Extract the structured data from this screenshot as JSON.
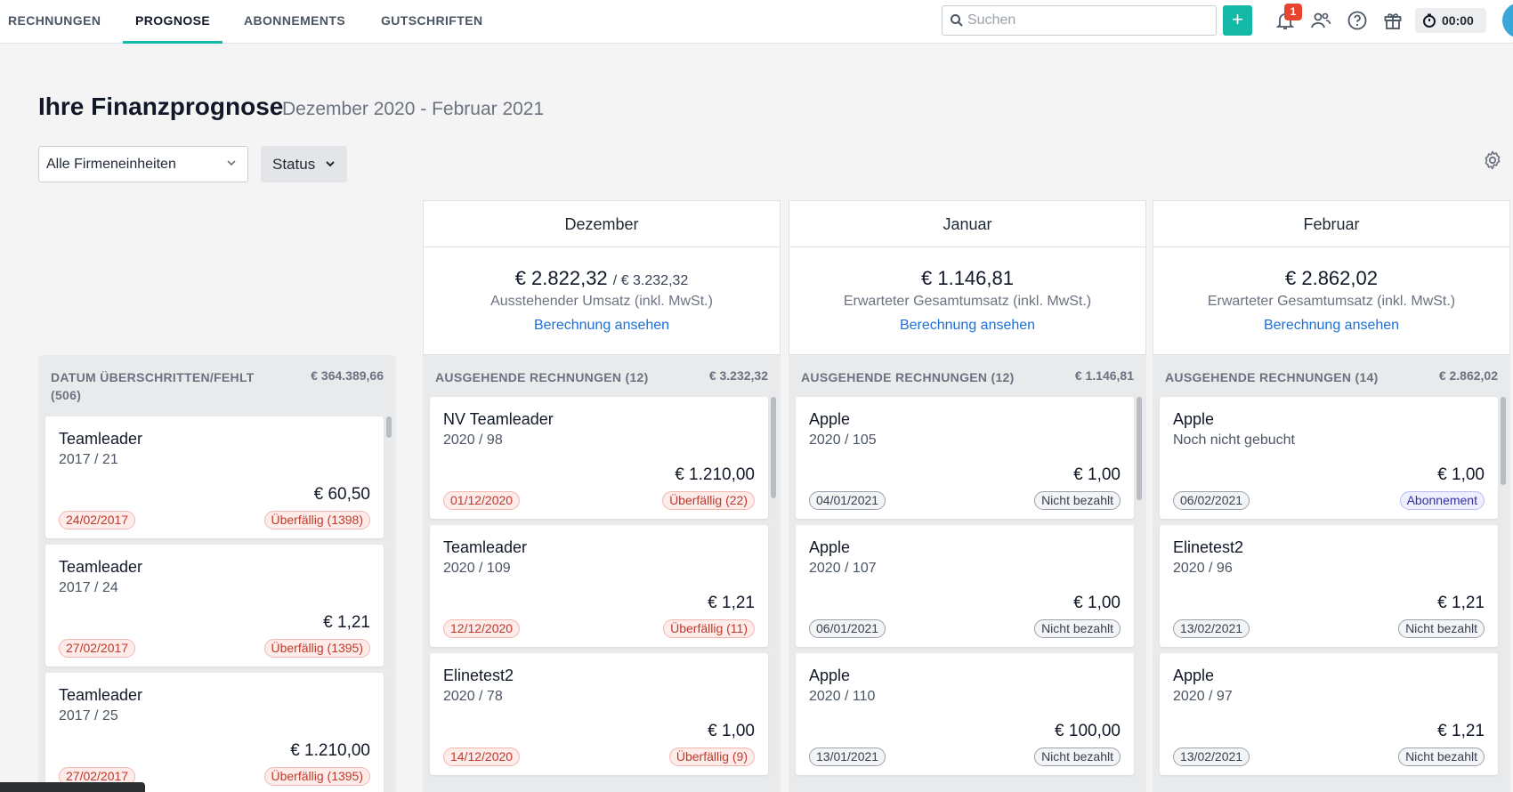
{
  "nav": {
    "tabs": [
      {
        "label": "RECHNUNGEN"
      },
      {
        "label": "PROGNOSE"
      },
      {
        "label": "ABONNEMENTS"
      },
      {
        "label": "GUTSCHRIFTEN"
      }
    ],
    "search_placeholder": "Suchen",
    "add_label": "+",
    "notification_count": "1",
    "timer": "00:00"
  },
  "heading": {
    "title": "Ihre Finanzprognose",
    "range": "Dezember 2020 - Februar 2021"
  },
  "filters": {
    "entity": "Alle Firmeneinheiten",
    "status": "Status"
  },
  "months": [
    {
      "title": "Dezember",
      "amount": "€ 2.822,32",
      "secondary": "/ € 3.232,32",
      "desc": "Ausstehender Umsatz (inkl. MwSt.)",
      "link": "Berechnung ansehen"
    },
    {
      "title": "Januar",
      "amount": "€ 1.146,81",
      "secondary": "",
      "desc": "Erwarteter Gesamtumsatz (inkl. MwSt.)",
      "link": "Berechnung ansehen"
    },
    {
      "title": "Februar",
      "amount": "€ 2.862,02",
      "secondary": "",
      "desc": "Erwarteter Gesamtumsatz (inkl. MwSt.)",
      "link": "Berechnung ansehen"
    }
  ],
  "columns": [
    {
      "header": "DATUM ÜBERSCHRITTEN/FEHLT (506)",
      "total": "€ 364.389,66",
      "cards": [
        {
          "name": "Teamleader",
          "number": "2017 / 21",
          "amount": "€ 60,50",
          "date": "24/02/2017",
          "status": "Überfällig (1398)",
          "date_style": "red",
          "status_style": "red"
        },
        {
          "name": "Teamleader",
          "number": "2017 / 24",
          "amount": "€ 1,21",
          "date": "27/02/2017",
          "status": "Überfällig (1395)",
          "date_style": "red",
          "status_style": "red"
        },
        {
          "name": "Teamleader",
          "number": "2017 / 25",
          "amount": "€ 1.210,00",
          "date": "27/02/2017",
          "status": "Überfällig (1395)",
          "date_style": "red",
          "status_style": "red"
        }
      ]
    },
    {
      "header": "AUSGEHENDE RECHNUNGEN (12)",
      "total": "€ 3.232,32",
      "cards": [
        {
          "name": "NV Teamleader",
          "number": "2020 / 98",
          "amount": "€ 1.210,00",
          "date": "01/12/2020",
          "status": "Überfällig (22)",
          "date_style": "red",
          "status_style": "red"
        },
        {
          "name": "Teamleader",
          "number": "2020 / 109",
          "amount": "€ 1,21",
          "date": "12/12/2020",
          "status": "Überfällig (11)",
          "date_style": "red",
          "status_style": "red"
        },
        {
          "name": "Elinetest2",
          "number": "2020 / 78",
          "amount": "€ 1,00",
          "date": "14/12/2020",
          "status": "Überfällig (9)",
          "date_style": "red",
          "status_style": "red"
        }
      ]
    },
    {
      "header": "AUSGEHENDE RECHNUNGEN (12)",
      "total": "€ 1.146,81",
      "cards": [
        {
          "name": "Apple",
          "number": "2020 / 105",
          "amount": "€ 1,00",
          "date": "04/01/2021",
          "status": "Nicht bezahlt",
          "date_style": "grey",
          "status_style": "grey"
        },
        {
          "name": "Apple",
          "number": "2020 / 107",
          "amount": "€ 1,00",
          "date": "06/01/2021",
          "status": "Nicht bezahlt",
          "date_style": "grey",
          "status_style": "grey"
        },
        {
          "name": "Apple",
          "number": "2020 / 110",
          "amount": "€ 100,00",
          "date": "13/01/2021",
          "status": "Nicht bezahlt",
          "date_style": "grey",
          "status_style": "grey"
        }
      ]
    },
    {
      "header": "AUSGEHENDE RECHNUNGEN (14)",
      "total": "€ 2.862,02",
      "cards": [
        {
          "name": "Apple",
          "number": "Noch nicht gebucht",
          "amount": "€ 1,00",
          "date": "06/02/2021",
          "status": "Abonnement",
          "date_style": "grey",
          "status_style": "blue"
        },
        {
          "name": "Elinetest2",
          "number": "2020 / 96",
          "amount": "€ 1,21",
          "date": "13/02/2021",
          "status": "Nicht bezahlt",
          "date_style": "grey",
          "status_style": "grey"
        },
        {
          "name": "Apple",
          "number": "2020 / 97",
          "amount": "€ 1,21",
          "date": "13/02/2021",
          "status": "Nicht bezahlt",
          "date_style": "grey",
          "status_style": "grey"
        }
      ]
    }
  ],
  "colors": {
    "accent": "#14b8a6",
    "link": "#1e6fd9",
    "overdue": "#c0392b",
    "badge": "#e8452f"
  }
}
